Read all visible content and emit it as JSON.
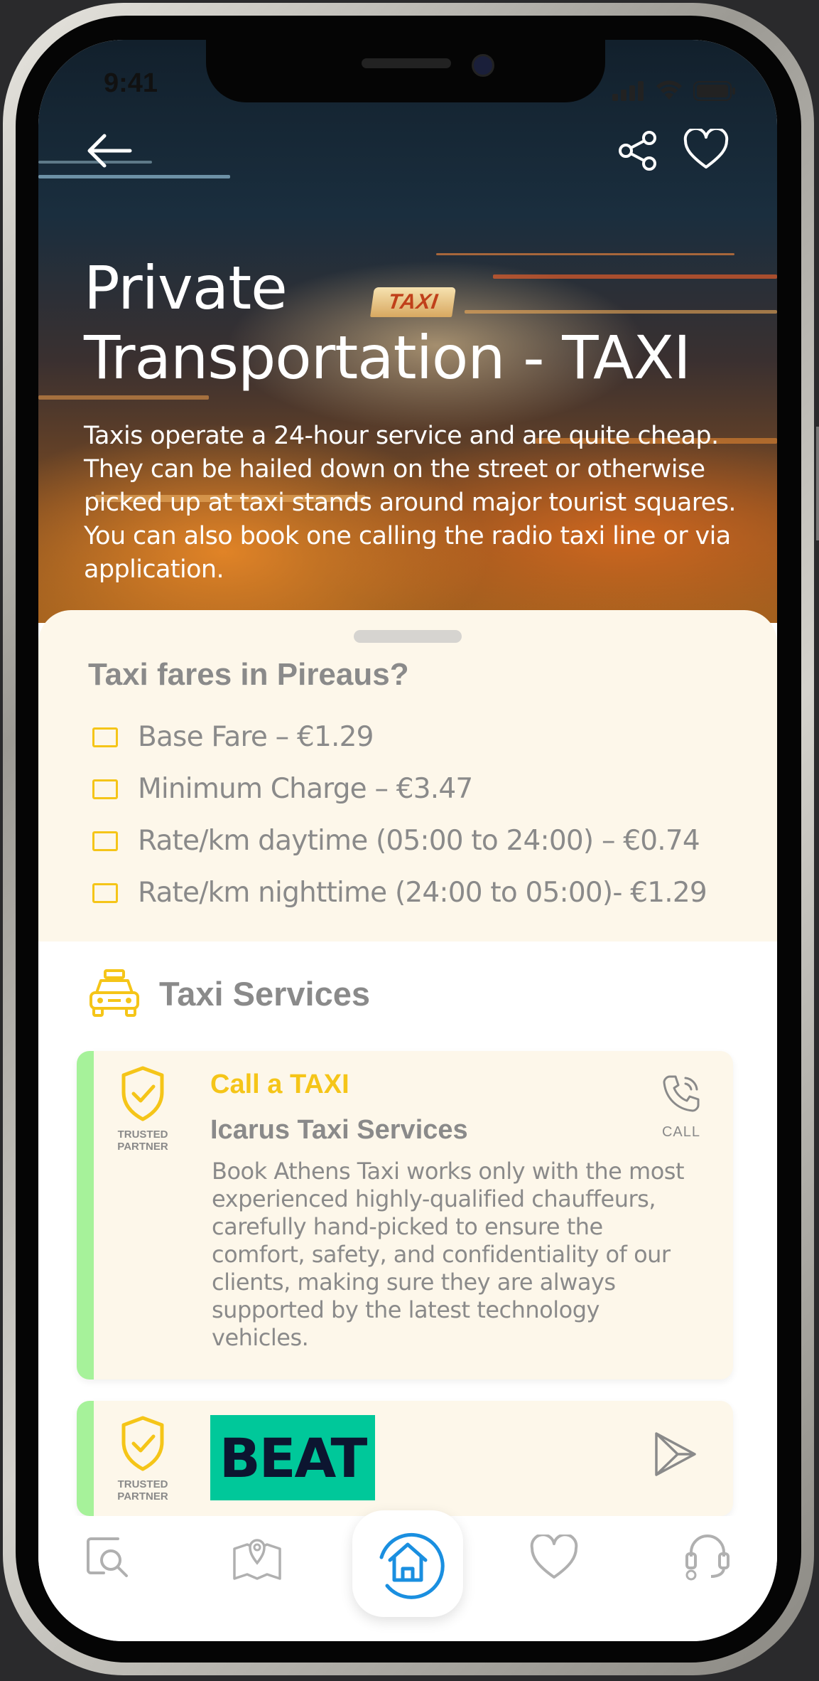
{
  "status_bar": {
    "time": "9:41"
  },
  "hero": {
    "title_line1": "Private",
    "title_line2": "Transportation - TAXI",
    "description": "Taxis operate a 24-hour service and are quite cheap. They can be hailed down on the street or otherwise picked up at taxi stands around major tourist squares. You can also book one calling the radio taxi line or via application.",
    "sign_text": "TAXI",
    "icons": {
      "back": "arrow-left-icon",
      "share": "share-icon",
      "favorite": "heart-icon"
    }
  },
  "fares": {
    "heading": "Taxi fares in Pireaus?",
    "items": [
      "Base Fare – €1.29",
      "Minimum Charge – €3.47",
      "Rate/km daytime (05:00 to 24:00) – €0.74",
      "Rate/km nighttime (24:00 to 05:00)- €1.29"
    ]
  },
  "services": {
    "title": "Taxi Services",
    "cards": [
      {
        "badge": "TRUSTED PARTNER",
        "kicker": "Call a TAXI",
        "name": "Icarus Taxi Services",
        "description": "Book Athens Taxi works only with the most experienced highly-qualified chauffeurs, carefully hand-picked to ensure the comfort, safety, and confidentiality of our clients, making sure they are always supported by the latest technology vehicles.",
        "action_label": "CALL"
      },
      {
        "badge": "TRUSTED PARTNER",
        "logo_text": "BEAT"
      }
    ]
  },
  "tabbar": {
    "tabs": [
      "search-map-icon",
      "map-icon",
      "home-icon",
      "heart-icon",
      "support-headset-icon"
    ]
  },
  "colors": {
    "accent_yellow": "#f5c518",
    "accent_green": "#a6f29a",
    "sheet_bg": "#fdf7ea",
    "text_gray": "#8a8a8a",
    "home_blue": "#1a8fe0",
    "beat_green": "#00c89a"
  }
}
